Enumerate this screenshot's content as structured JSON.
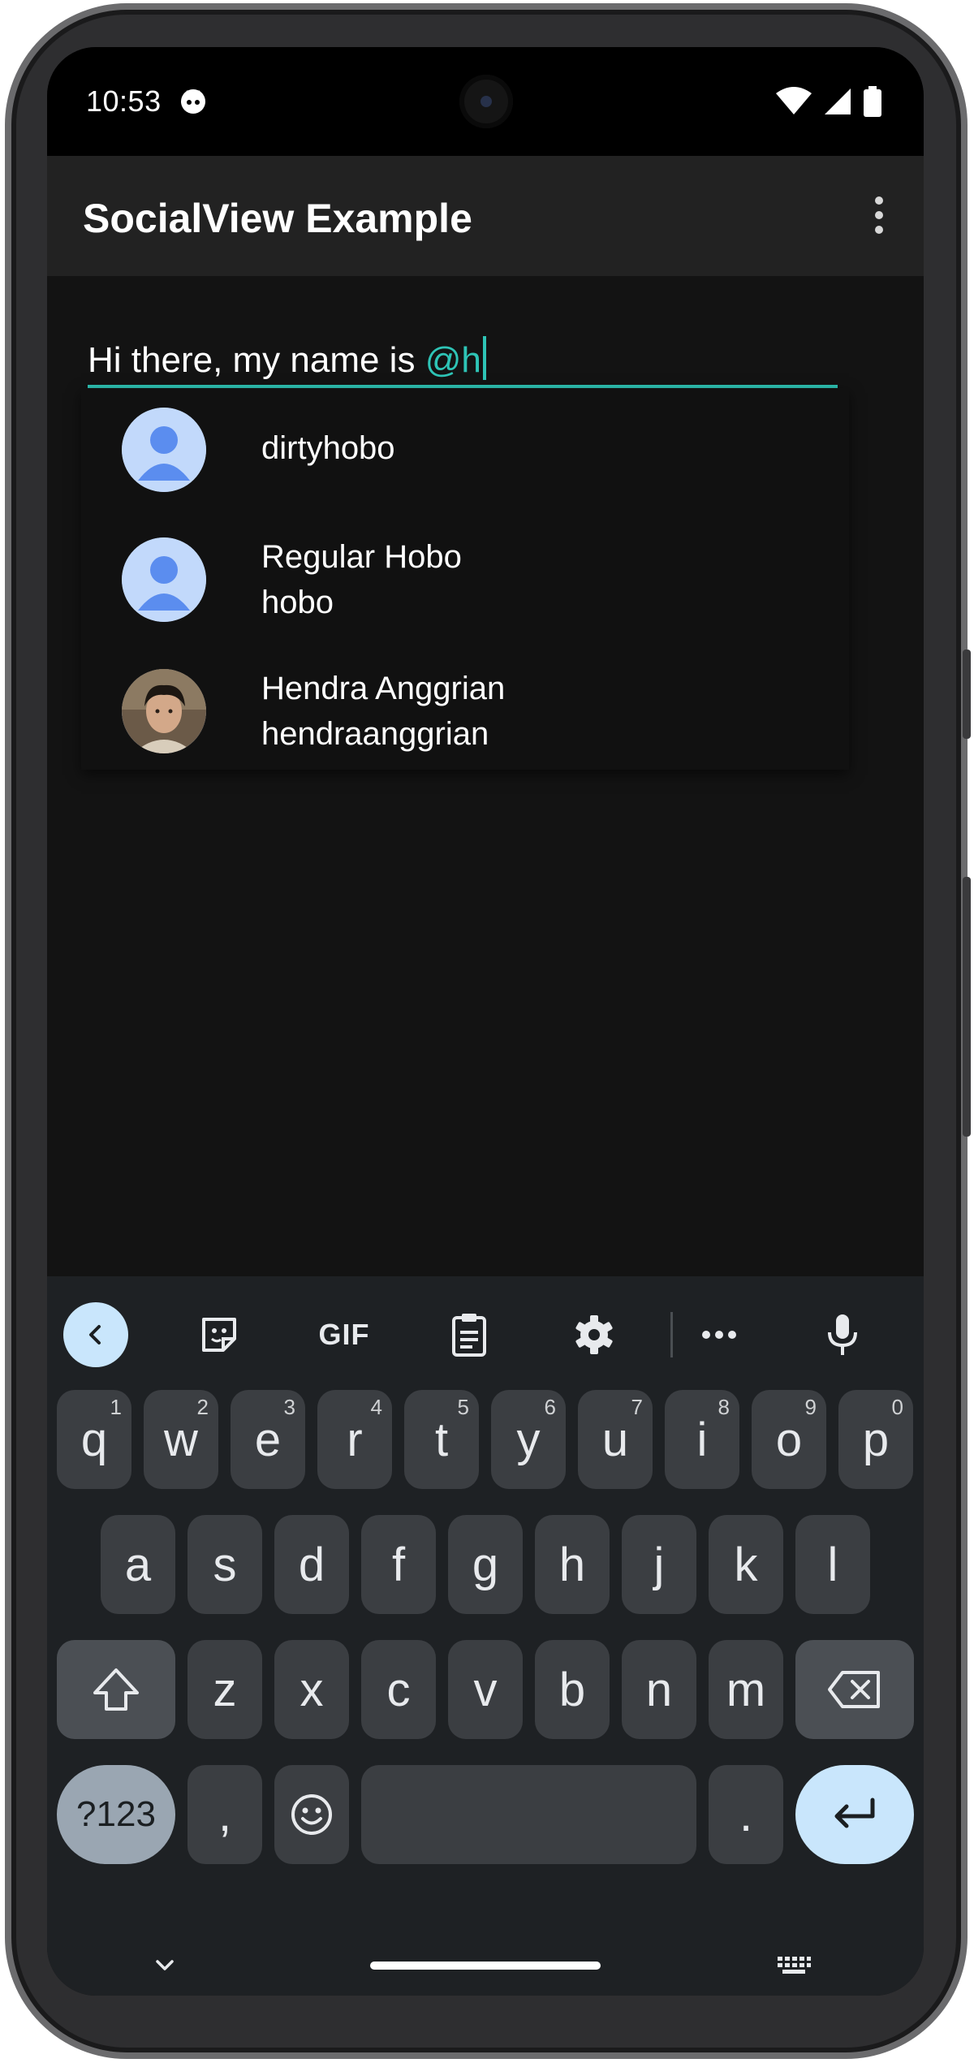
{
  "status_bar": {
    "time": "10:53",
    "icons": [
      "app-notification-icon",
      "wifi-icon",
      "cell-signal-icon",
      "battery-icon"
    ]
  },
  "toolbar": {
    "title": "SocialView Example",
    "overflow_icon": "more-vert-icon"
  },
  "input": {
    "text_prefix": "Hi there, my name is ",
    "mention": "@h"
  },
  "suggestions": [
    {
      "name": "dirtyhobo",
      "username": "",
      "avatar": "default-person"
    },
    {
      "name": "Regular Hobo",
      "username": "hobo",
      "avatar": "default-person"
    },
    {
      "name": "Hendra Anggrian",
      "username": "hendraanggrian",
      "avatar": "photo"
    }
  ],
  "keyboard": {
    "toolbar": [
      "back-icon",
      "sticker-icon",
      "GIF",
      "clipboard-icon",
      "settings-icon",
      "more-horiz-icon",
      "microphone-icon"
    ],
    "gif_label": "GIF",
    "row1": [
      {
        "k": "q",
        "d": "1"
      },
      {
        "k": "w",
        "d": "2"
      },
      {
        "k": "e",
        "d": "3"
      },
      {
        "k": "r",
        "d": "4"
      },
      {
        "k": "t",
        "d": "5"
      },
      {
        "k": "y",
        "d": "6"
      },
      {
        "k": "u",
        "d": "7"
      },
      {
        "k": "i",
        "d": "8"
      },
      {
        "k": "o",
        "d": "9"
      },
      {
        "k": "p",
        "d": "0"
      }
    ],
    "row2": [
      "a",
      "s",
      "d",
      "f",
      "g",
      "h",
      "j",
      "k",
      "l"
    ],
    "row3": [
      "z",
      "x",
      "c",
      "v",
      "b",
      "n",
      "m"
    ],
    "symbols_label": "?123",
    "comma_label": ",",
    "period_label": ".",
    "nav_hide_icon": "chevron-down-icon",
    "nav_keyboard_icon": "keyboard-icon"
  },
  "colors": {
    "accent": "#2ec4b6",
    "background": "#131313",
    "toolbar": "#222222",
    "key": "#3b3e42",
    "enter_key": "#c9e6fc"
  }
}
